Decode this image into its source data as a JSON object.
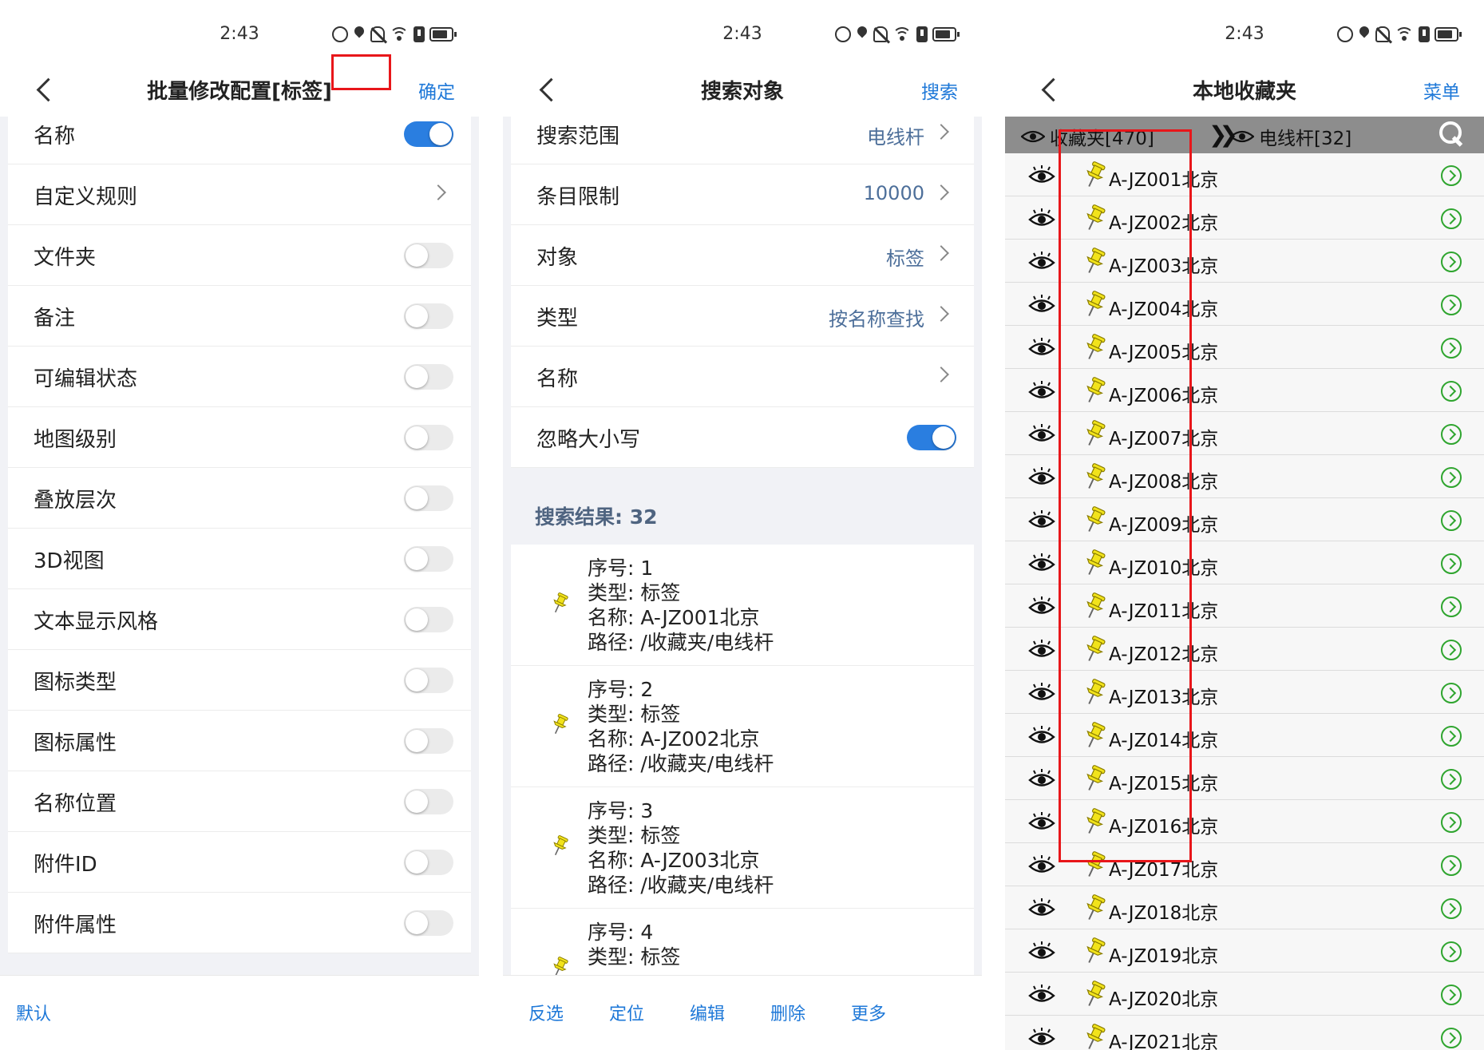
{
  "status": {
    "time": "2:43"
  },
  "screen1": {
    "title": "批量修改配置[标签]",
    "confirm_label": "确定",
    "rows": [
      {
        "label": "名称",
        "on": true
      },
      {
        "label": "自定义规则"
      },
      {
        "label": "文件夹",
        "on": false
      },
      {
        "label": "备注",
        "on": false
      },
      {
        "label": "可编辑状态",
        "on": false
      },
      {
        "label": "地图级别",
        "on": false
      },
      {
        "label": "叠放层次",
        "on": false
      },
      {
        "label": "3D视图",
        "on": false
      },
      {
        "label": "文本显示风格",
        "on": false
      },
      {
        "label": "图标类型",
        "on": false
      },
      {
        "label": "图标属性",
        "on": false
      },
      {
        "label": "名称位置",
        "on": false
      },
      {
        "label": "附件ID",
        "on": false
      },
      {
        "label": "附件属性",
        "on": false
      }
    ],
    "bottom_label": "默认"
  },
  "screen2": {
    "title": "搜索对象",
    "search_label": "搜索",
    "rows": [
      {
        "label": "搜索范围",
        "value": "电线杆"
      },
      {
        "label": "条目限制",
        "value": "10000"
      },
      {
        "label": "对象",
        "value": "标签"
      },
      {
        "label": "类型",
        "value": "按名称查找"
      },
      {
        "label": "名称",
        "value": ""
      },
      {
        "label": "忽略大小写",
        "on": true
      }
    ],
    "results_label": "搜索结果: 32",
    "results": [
      {
        "seq": "序号: 1",
        "type": "类型: 标签",
        "name": "名称: A-JZ001北京",
        "path": "路径: /收藏夹/电线杆"
      },
      {
        "seq": "序号: 2",
        "type": "类型: 标签",
        "name": "名称: A-JZ002北京",
        "path": "路径: /收藏夹/电线杆"
      },
      {
        "seq": "序号: 3",
        "type": "类型: 标签",
        "name": "名称: A-JZ003北京",
        "path": "路径: /收藏夹/电线杆"
      },
      {
        "seq": "序号: 4",
        "type": "类型: 标签",
        "name": "",
        "path": ""
      }
    ],
    "bottom": [
      "反选",
      "定位",
      "编辑",
      "删除",
      "更多"
    ]
  },
  "screen3": {
    "title": "本地收藏夹",
    "menu_label": "菜单",
    "tab_folder": "收藏夹[470]",
    "tab_sub": "电线杆[32]",
    "items": [
      "A-JZ001北京",
      "A-JZ002北京",
      "A-JZ003北京",
      "A-JZ004北京",
      "A-JZ005北京",
      "A-JZ006北京",
      "A-JZ007北京",
      "A-JZ008北京",
      "A-JZ009北京",
      "A-JZ010北京",
      "A-JZ011北京",
      "A-JZ012北京",
      "A-JZ013北京",
      "A-JZ014北京",
      "A-JZ015北京",
      "A-JZ016北京",
      "A-JZ017北京",
      "A-JZ018北京",
      "A-JZ019北京",
      "A-JZ020北京",
      "A-JZ021北京"
    ]
  },
  "colors": {
    "accent": "#1e78d8",
    "highlight": "#e8161a",
    "toggle_on": "#2a7ee0",
    "go_green": "#2fa52f",
    "pin_yellow": "#f2e31b"
  }
}
